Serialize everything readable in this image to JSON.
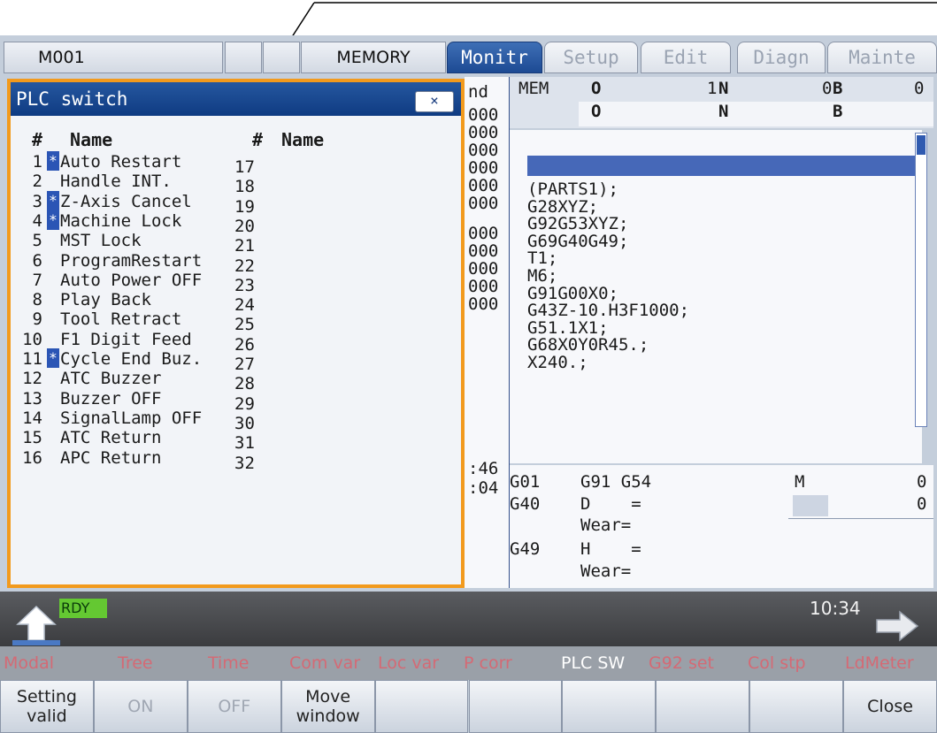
{
  "top": {
    "program": "M001",
    "mode": "MEMORY",
    "tabs": [
      "Monitr",
      "Setup",
      "Edit",
      "Diagn",
      "Mainte"
    ],
    "active_tab": "Monitr"
  },
  "monitor": {
    "left_fragments": [
      "nd",
      "000",
      "000",
      "000",
      "000",
      "000",
      "000",
      "000",
      "000",
      "000",
      "000",
      "000",
      ":46",
      ":04"
    ],
    "state_row1": {
      "mem": "MEM",
      "o": "O",
      "o_val": "1",
      "n": "N",
      "n_val": "0",
      "b": "B",
      "b_val": "0"
    },
    "state_row2": {
      "o": "O",
      "n": "N",
      "b": "B"
    },
    "program_lines": [
      "(PARTS1);",
      "G28XYZ;",
      "G92G53XYZ;",
      "G69G40G49;",
      "T1;",
      "M6;",
      "G91G00X0;",
      "G43Z-10.H3F1000;",
      "G51.1X1;",
      "G68X0Y0R45.;",
      "X240.;"
    ],
    "modal": {
      "row1": {
        "g1": "G01",
        "g2": "G91 G54",
        "m": "M",
        "m_val": "0"
      },
      "row2": {
        "g1": "G40",
        "d": "D    =",
        "d_val": "0"
      },
      "row3": {
        "wear": "Wear="
      },
      "row4": {
        "g1": "G49",
        "h": "H    ="
      },
      "row5": {
        "wear": "Wear="
      }
    }
  },
  "popup": {
    "title": "PLC switch",
    "close_label": "×",
    "col_hash": "#",
    "col_name": "Name",
    "rows": [
      {
        "num": "1",
        "star": true,
        "name": "Auto Restart",
        "num2": "17"
      },
      {
        "num": "2",
        "star": false,
        "name": "Handle INT.",
        "num2": "18"
      },
      {
        "num": "3",
        "star": true,
        "name": "Z-Axis Cancel",
        "num2": "19"
      },
      {
        "num": "4",
        "star": true,
        "name": "Machine Lock",
        "num2": "20"
      },
      {
        "num": "5",
        "star": false,
        "name": "MST Lock",
        "num2": "21"
      },
      {
        "num": "6",
        "star": false,
        "name": "ProgramRestart",
        "num2": "22"
      },
      {
        "num": "7",
        "star": false,
        "name": "Auto Power OFF",
        "num2": "23"
      },
      {
        "num": "8",
        "star": false,
        "name": "Play Back",
        "num2": "24"
      },
      {
        "num": "9",
        "star": false,
        "name": "Tool Retract",
        "num2": "25"
      },
      {
        "num": "10",
        "star": false,
        "name": "F1 Digit Feed",
        "num2": "26"
      },
      {
        "num": "11",
        "star": true,
        "name": "Cycle End Buz.",
        "num2": "27"
      },
      {
        "num": "12",
        "star": false,
        "name": "ATC Buzzer",
        "num2": "28"
      },
      {
        "num": "13",
        "star": false,
        "name": "Buzzer OFF",
        "num2": "29"
      },
      {
        "num": "14",
        "star": false,
        "name": "SignalLamp OFF",
        "num2": "30"
      },
      {
        "num": "15",
        "star": false,
        "name": "ATC Return",
        "num2": "31"
      },
      {
        "num": "16",
        "star": false,
        "name": "APC Return",
        "num2": "32"
      }
    ],
    "star_glyph": "*"
  },
  "status": {
    "rdy": "RDY",
    "clock": "10:34"
  },
  "menu": [
    "Modal",
    "Tree",
    "Time",
    "Com var",
    "Loc var",
    "P corr",
    "PLC SW",
    "G92 set",
    "Col stp",
    "LdMeter"
  ],
  "menu_active": "PLC SW",
  "softkeys": [
    {
      "label": "Setting\nvalid",
      "dim": false
    },
    {
      "label": "ON",
      "dim": true
    },
    {
      "label": "OFF",
      "dim": true
    },
    {
      "label": "Move\nwindow",
      "dim": false
    },
    {
      "label": "",
      "dim": false
    },
    {
      "label": "",
      "dim": false
    },
    {
      "label": "",
      "dim": false
    },
    {
      "label": "",
      "dim": false
    },
    {
      "label": "",
      "dim": false
    },
    {
      "label": "Close",
      "dim": false
    }
  ],
  "colors": {
    "accent": "#1d4a93",
    "frame": "#f29a1d",
    "star_bg": "#2b55b5",
    "rdy": "#64c832"
  }
}
